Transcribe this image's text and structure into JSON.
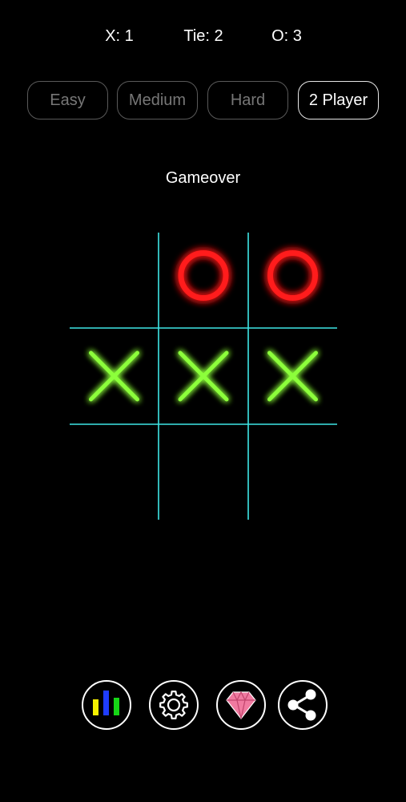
{
  "scores": {
    "x_label": "X:",
    "x_value": "1",
    "tie_label": "Tie:",
    "tie_value": "2",
    "o_label": "O:",
    "o_value": "3"
  },
  "modes": [
    {
      "label": "Easy",
      "active": false
    },
    {
      "label": "Medium",
      "active": false
    },
    {
      "label": "Hard",
      "active": false
    },
    {
      "label": "2 Player",
      "active": true
    }
  ],
  "status": "Gameover",
  "board": {
    "cells": [
      "",
      "O",
      "O",
      "X",
      "X",
      "X",
      "",
      "",
      ""
    ],
    "winning_line": "row-2",
    "colors": {
      "grid": "#3ee6e6",
      "x": "#8cff3a",
      "o": "#ff1a1a"
    }
  },
  "toolbar": {
    "stats_icon": "bar-chart-icon",
    "settings_icon": "gear-icon",
    "premium_icon": "diamond-icon",
    "share_icon": "share-icon",
    "stats_colors": [
      "#f5f000",
      "#1f3dff",
      "#16d616"
    ],
    "diamond_color": "#f07aa0"
  }
}
